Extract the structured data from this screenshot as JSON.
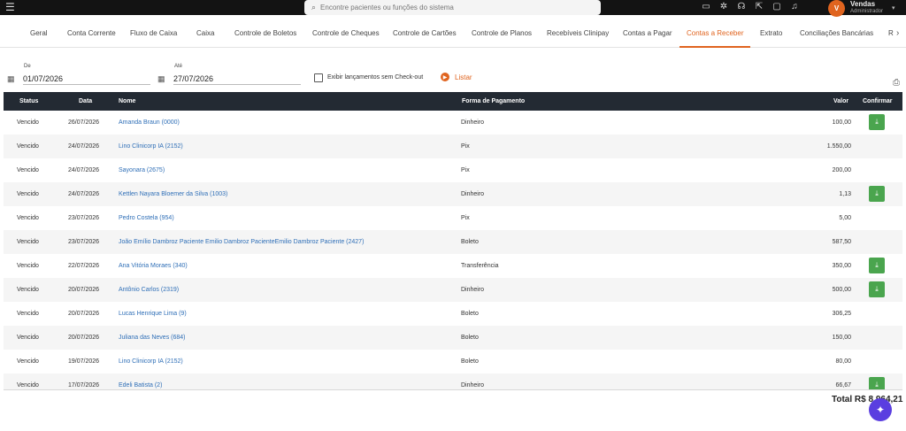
{
  "topbar": {
    "search_placeholder": "Encontre pacientes ou funções do sistema",
    "icons": [
      "video-icon",
      "sun-icon",
      "headset-icon",
      "share-icon",
      "chat-icon",
      "bell-icon"
    ],
    "user": {
      "initial": "V",
      "name": "Vendas",
      "role": "Administrador"
    }
  },
  "tabs": [
    "Geral",
    "Conta Corrente",
    "Fluxo de Caixa",
    "Caixa",
    "Controle de Boletos",
    "Controle de Cheques",
    "Controle de Cartões",
    "Controle de Planos",
    "Recebíveis Clinipay",
    "Contas a Pagar",
    "Contas a Receber",
    "Extrato",
    "Conciliações Bancárias",
    "R"
  ],
  "active_tab": "Contas a Receber",
  "filters": {
    "from_label": "De",
    "from_value": "01/07/2026",
    "to_label": "Até",
    "to_value": "27/07/2026",
    "checkout_label": "Exibir lançamentos sem Check-out",
    "list_button": "Listar"
  },
  "table": {
    "headers": {
      "status": "Status",
      "date": "Data",
      "name": "Nome",
      "payment": "Forma de Pagamento",
      "value": "Valor",
      "confirm": "Confirmar"
    },
    "rows": [
      {
        "status": "Vencido",
        "date": "26/07/2026",
        "name": "Amanda Braun (0000)",
        "payment": "Dinheiro",
        "value": "100,00",
        "confirm": true
      },
      {
        "status": "Vencido",
        "date": "24/07/2026",
        "name": "Lino Clinicorp IA (2152)",
        "payment": "Pix",
        "value": "1.550,00",
        "confirm": false
      },
      {
        "status": "Vencido",
        "date": "24/07/2026",
        "name": "Sayonara (2675)",
        "payment": "Pix",
        "value": "200,00",
        "confirm": false
      },
      {
        "status": "Vencido",
        "date": "24/07/2026",
        "name": "Kettlen Nayara Bloemer da Silva (1003)",
        "payment": "Dinheiro",
        "value": "1,13",
        "confirm": true
      },
      {
        "status": "Vencido",
        "date": "23/07/2026",
        "name": "Pedro Costela (954)",
        "payment": "Pix",
        "value": "5,00",
        "confirm": false
      },
      {
        "status": "Vencido",
        "date": "23/07/2026",
        "name": "João Emílio Dambroz Paciente Emilio Dambroz PacienteEmilio Dambroz Paciente (2427)",
        "payment": "Boleto",
        "value": "587,50",
        "confirm": false
      },
      {
        "status": "Vencido",
        "date": "22/07/2026",
        "name": "Ana Vitória Moraes (340)",
        "payment": "Transferência",
        "value": "350,00",
        "confirm": true
      },
      {
        "status": "Vencido",
        "date": "20/07/2026",
        "name": "Antônio Carlos (2319)",
        "payment": "Dinheiro",
        "value": "500,00",
        "confirm": true
      },
      {
        "status": "Vencido",
        "date": "20/07/2026",
        "name": "Lucas Henrique Lima (9)",
        "payment": "Boleto",
        "value": "306,25",
        "confirm": false
      },
      {
        "status": "Vencido",
        "date": "20/07/2026",
        "name": "Juliana das Neves (684)",
        "payment": "Boleto",
        "value": "150,00",
        "confirm": false
      },
      {
        "status": "Vencido",
        "date": "19/07/2026",
        "name": "Lino Clinicorp IA (2152)",
        "payment": "Boleto",
        "value": "80,00",
        "confirm": false
      },
      {
        "status": "Vencido",
        "date": "17/07/2026",
        "name": "Edeli Batista (2)",
        "payment": "Dinheiro",
        "value": "66,67",
        "confirm": true
      }
    ]
  },
  "total": "Total R$ 8.964,21",
  "colors": {
    "accent": "#e0641f",
    "header_bg": "#232a33",
    "confirm_green": "#4aa54e",
    "link": "#2f6fb7",
    "fab": "#5a3ee0"
  }
}
